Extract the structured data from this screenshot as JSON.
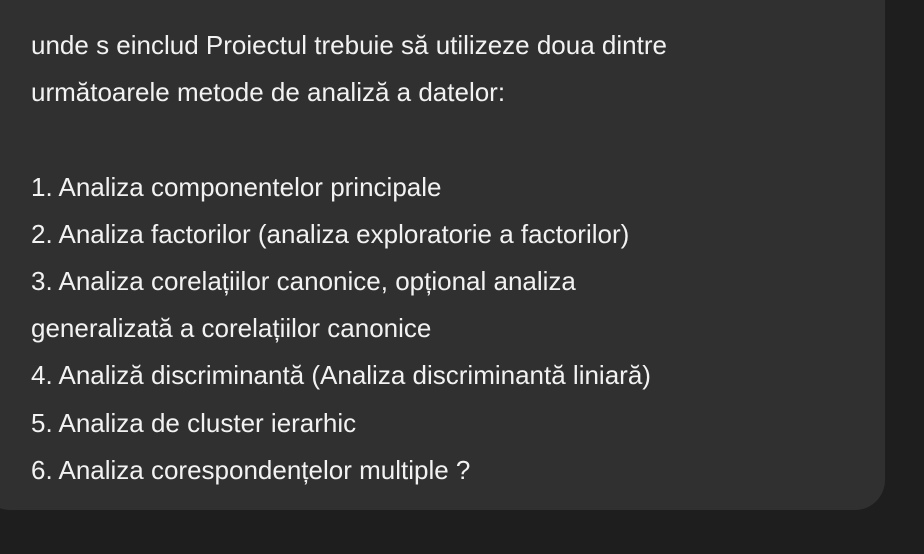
{
  "message": {
    "lines": [
      "unde s einclud Proiectul trebuie să utilizeze doua dintre",
      "următoarele metode de analiză a datelor:",
      "",
      "1. Analiza componentelor principale",
      "2. Analiza factorilor (analiza exploratorie a factorilor)",
      "3. Analiza corelațiilor canonice, opțional analiza",
      "generalizată a corelațiilor canonice",
      "4. Analiză discriminantă (Analiza discriminantă liniară)",
      "5. Analiza de cluster ierarhic",
      "6. Analiza corespondențelor multiple ?"
    ]
  }
}
